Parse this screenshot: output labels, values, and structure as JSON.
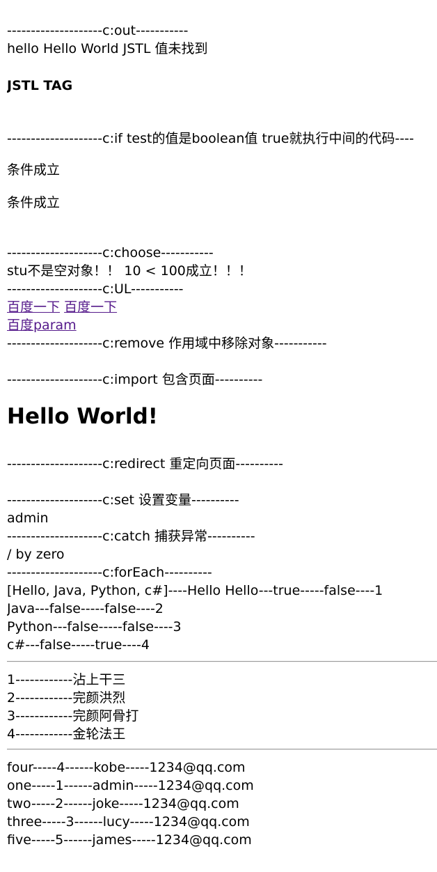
{
  "out": {
    "header": "--------------------c:out-----------",
    "text": "hello Hello World JSTL 值未找到",
    "tag": "JSTL TAG"
  },
  "if": {
    "header": "--------------------c:if test的值是boolean值 true就执行中间的代码----",
    "line1": "条件成立",
    "line2": "条件成立"
  },
  "choose": {
    "header": "--------------------c:choose-----------",
    "text": "stu不是空对象！！ 10 < 100成立！！！"
  },
  "url": {
    "header": "--------------------c:UL-----------",
    "link1": "百度一下",
    "link2": "百度一下",
    "link3": "百度param"
  },
  "remove": {
    "header": "--------------------c:remove 作用域中移除对象-----------"
  },
  "import": {
    "header": "--------------------c:import 包含页面----------",
    "heading": "Hello World!"
  },
  "redirect": {
    "header": "--------------------c:redirect 重定向页面----------"
  },
  "set": {
    "header": "--------------------c:set 设置变量----------",
    "value": "admin"
  },
  "catch": {
    "header": "--------------------c:catch 捕获异常----------",
    "value": "/ by zero"
  },
  "foreach": {
    "header": "--------------------c:forEach----------",
    "rows": [
      "[Hello, Java, Python, c#]----Hello Hello---true-----false----1",
      "Java---false-----false----2",
      "Python---false-----false----3",
      "c#---false-----true----4"
    ]
  },
  "names": [
    "1------------沾上干三",
    "2------------完颜洪烈",
    "3------------完颜阿骨打",
    "4------------金轮法王"
  ],
  "users": [
    "four-----4------kobe-----1234@qq.com",
    "one-----1------admin-----1234@qq.com",
    "two-----2------joke-----1234@qq.com",
    "three-----3------lucy-----1234@qq.com",
    "five-----5------james-----1234@qq.com"
  ],
  "colors": {
    "text": "#000000",
    "link": "#551a8b",
    "rule": "#9a9a9a",
    "background": "#ffffff"
  }
}
